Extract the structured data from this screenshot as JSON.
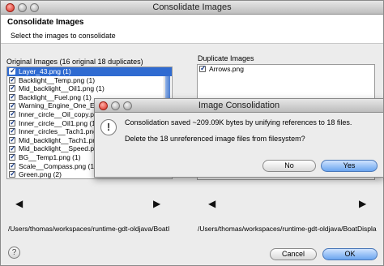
{
  "window": {
    "title": "Consolidate Images"
  },
  "header": {
    "title": "Consolidate Images",
    "subtitle": "Select the images to consolidate"
  },
  "original": {
    "label": "Original Images (16 original 18 duplicates)",
    "items": [
      {
        "label": "Layer_43.png (1)",
        "checked": true,
        "selected": true
      },
      {
        "label": "Backlight__Temp.png (1)",
        "checked": true
      },
      {
        "label": "Mid_backlight__Oil1.png (1)",
        "checked": true
      },
      {
        "label": "Backlight__Fuel.png (1)",
        "checked": true
      },
      {
        "label": "Warning_Engine_One_E1.",
        "checked": true
      },
      {
        "label": "Inner_circle__Oil_copy.pn",
        "checked": true
      },
      {
        "label": "Inner_circle__Oil1.png (1",
        "checked": true
      },
      {
        "label": "Inner_circles__Tach1.png",
        "checked": true
      },
      {
        "label": "Mid_backlight__Tach1.png",
        "checked": true
      },
      {
        "label": "Mid_backlight__Speed.pn",
        "checked": true
      },
      {
        "label": "BG__Temp1.png (1)",
        "checked": true
      },
      {
        "label": "Scale__Compass.png (1)",
        "checked": true
      },
      {
        "label": "Green.png (2)",
        "checked": true
      }
    ],
    "path": "/Users/thomas/workspaces/runtime-gdt-oldjava/BoatI"
  },
  "duplicate": {
    "label": "Duplicate Images",
    "items": [
      {
        "label": "Arrows.png",
        "checked": true
      }
    ],
    "path": "/Users/thomas/workspaces/runtime-gdt-oldjava/BoatDispla"
  },
  "nav": {
    "left": "◀",
    "right": "▶"
  },
  "help": {
    "label": "?"
  },
  "buttons": {
    "cancel": "Cancel",
    "ok": "OK"
  },
  "dialog": {
    "title": "Image Consolidation",
    "icon": "!",
    "message1": "Consolidation saved ~209.09K bytes by unifying references to 18 files.",
    "message2": "Delete the 18 unreferenced image files from filesystem?",
    "no": "No",
    "yes": "Yes"
  },
  "colors": {
    "selection": "#2f6bd1",
    "primary_button": "#6aa5ef",
    "close_button": "#d8281c"
  }
}
